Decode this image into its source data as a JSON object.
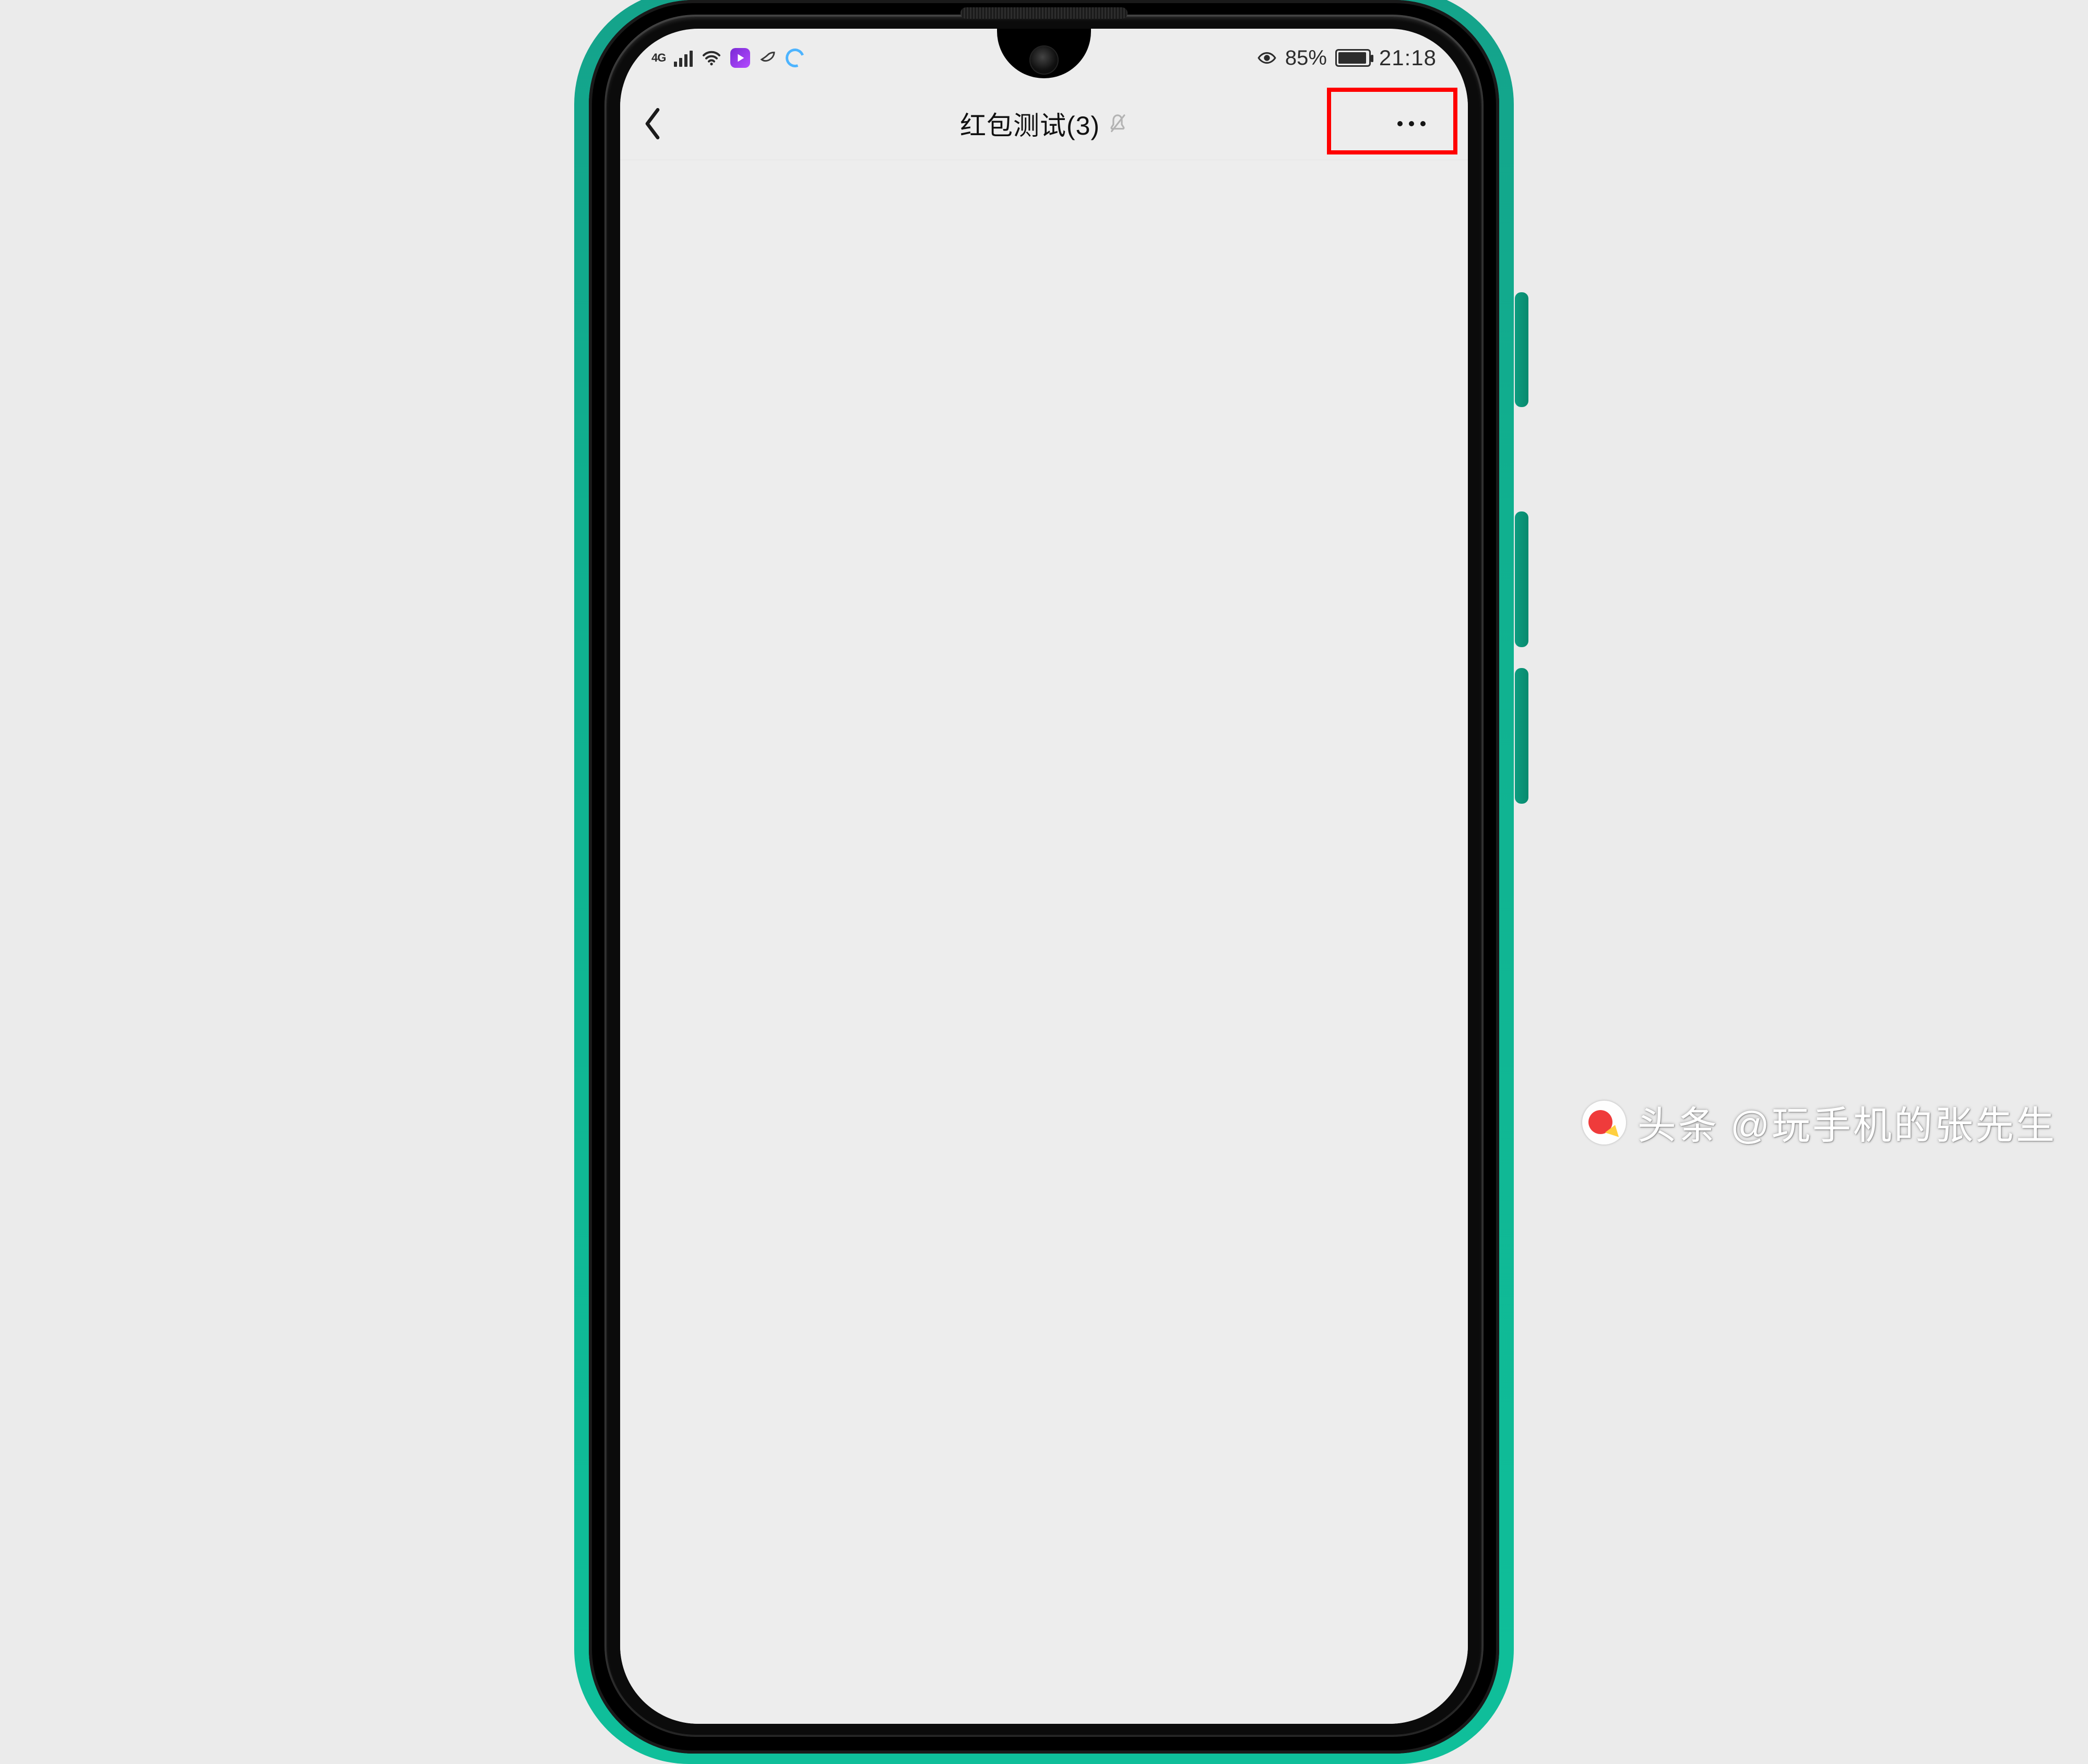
{
  "status": {
    "network_label": "4G",
    "battery_percent_text": "85%",
    "battery_percent": 85,
    "time": "21:18"
  },
  "nav": {
    "chat_title_base": "红包测试",
    "chat_member_count": "3",
    "chat_title_full": "红包测试(3)",
    "muted": true
  },
  "watermark": {
    "label": "头条",
    "handle": "@玩手机的张先生"
  },
  "highlight": {
    "target": "nav-more"
  }
}
